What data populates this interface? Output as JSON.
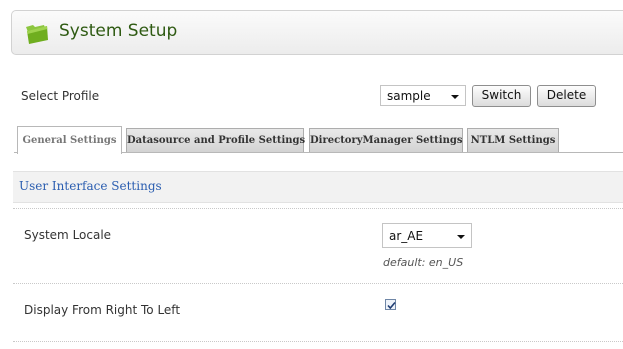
{
  "header": {
    "title": "System Setup",
    "icon": "folder-icon"
  },
  "profile": {
    "label": "Select Profile",
    "selected": "sample",
    "switch_label": "Switch",
    "delete_label": "Delete"
  },
  "tabs": [
    {
      "label": "General Settings",
      "active": true
    },
    {
      "label": "Datasource and Profile Settings",
      "active": false
    },
    {
      "label": "DirectoryManager Settings",
      "active": false
    },
    {
      "label": "NTLM Settings",
      "active": false
    }
  ],
  "section": {
    "title": "User Interface Settings"
  },
  "settings": {
    "locale": {
      "label": "System Locale",
      "value": "ar_AE",
      "default_note": "default: en_US"
    },
    "rtl": {
      "label": "Display From Right To Left",
      "checked": true
    }
  },
  "colors": {
    "title": "#2e5a12",
    "section_title": "#2a5db0",
    "folder": "#6fae1f"
  }
}
